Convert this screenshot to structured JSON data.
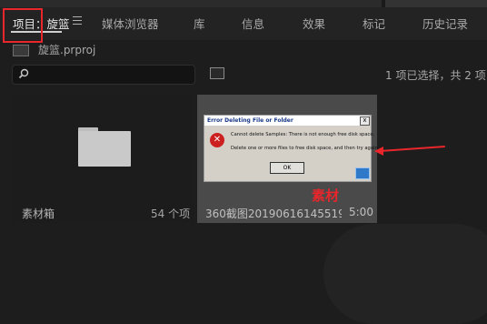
{
  "tabs": [
    {
      "label": "项目：",
      "active": true
    },
    {
      "label": "旋篮",
      "active": true
    },
    {
      "label": "媒体浏览器"
    },
    {
      "label": "库"
    },
    {
      "label": "信息"
    },
    {
      "label": "效果"
    },
    {
      "label": "标记"
    },
    {
      "label": "历史记录"
    }
  ],
  "project": {
    "filename": "旋篮.prproj"
  },
  "search": {
    "placeholder": ""
  },
  "status": {
    "selection": "1 项已选择，共 2 项"
  },
  "items": [
    {
      "label": "素材箱",
      "count": "54 个项",
      "icon": "folder-icon"
    },
    {
      "label": "360截图2019061614551903...",
      "duration": "5:00"
    }
  ],
  "dialog": {
    "title": "Error Deleting File or Folder",
    "close": "x",
    "message_1": "Cannot delete Samples: There is not enough free disk space.",
    "message_2": "Delete one or more files to free disk space, and then try again.",
    "ok": "OK",
    "icon": "error-icon"
  },
  "annotation": {
    "label": "素材",
    "color": "#e8262b"
  }
}
